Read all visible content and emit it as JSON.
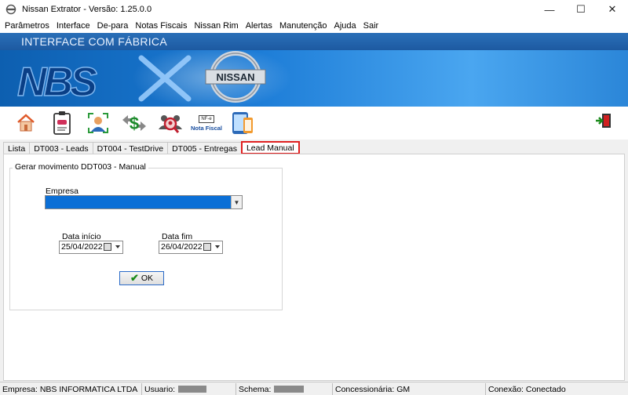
{
  "window": {
    "title": "Nissan Extrator - Versão: 1.25.0.0",
    "minimize": "—",
    "maximize": "☐",
    "close": "✕"
  },
  "menu": [
    "Parâmetros",
    "Interface",
    "De-para",
    "Notas Fiscais",
    "Nissan Rim",
    "Alertas",
    "Manutenção",
    "Ajuda",
    "Sair"
  ],
  "banner": {
    "strip_title": "INTERFACE COM FÁBRICA",
    "logo_left": "NBS",
    "logo_right": "NISSAN"
  },
  "toolbar": {
    "icons": [
      "home-icon",
      "clipboard-car-icon",
      "user-scan-icon",
      "money-transfer-icon",
      "user-search-icon",
      "nota-fiscal-icon",
      "mobile-device-icon"
    ],
    "nf_badge": "NF-e",
    "nota_fiscal_label": "Nota Fiscal",
    "exit_icon": "exit-door-icon"
  },
  "tabs": [
    {
      "label": "Lista",
      "active": false
    },
    {
      "label": "DT003 - Leads",
      "active": false
    },
    {
      "label": "DT004 - TestDrive",
      "active": false
    },
    {
      "label": "DT005 - Entregas",
      "active": false
    },
    {
      "label": "Lead Manual",
      "active": true
    }
  ],
  "form": {
    "group_title": "Gerar movimento DDT003 -  Manual",
    "empresa_label": "Empresa",
    "empresa_value": "",
    "date_start_label": "Data início",
    "date_start_value": "25/04/2022",
    "date_end_label": "Data fim",
    "date_end_value": "26/04/2022",
    "ok_label": "OK"
  },
  "status": {
    "empresa": "Empresa: NBS INFORMATICA LTDA",
    "usuario": "Usuario:",
    "schema": "Schema:",
    "concessionaria": "Concessionária: GM",
    "conexao": "Conexão: Conectado"
  },
  "colors": {
    "accent_select": "#0b6fd6",
    "active_tab_border": "#e02020",
    "banner_blue": "#1b7bd6"
  }
}
